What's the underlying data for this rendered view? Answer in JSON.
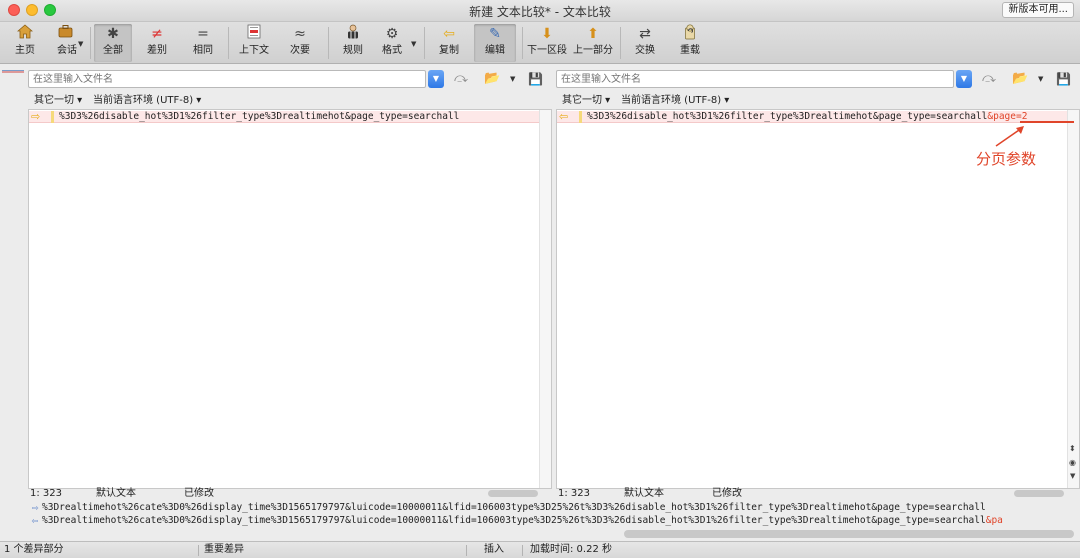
{
  "window": {
    "title": "新建 文本比较* - 文本比较",
    "update_button": "新版本可用..."
  },
  "toolbar": {
    "items": [
      {
        "label": "主页",
        "icon": "home-icon"
      },
      {
        "label": "会话",
        "icon": "briefcase-icon"
      },
      {
        "label": "全部",
        "icon": "asterisk-icon",
        "glyph": "✱",
        "active": true
      },
      {
        "label": "差别",
        "icon": "not-equal-icon",
        "glyph": "≠"
      },
      {
        "label": "相同",
        "icon": "equal-icon",
        "glyph": "="
      },
      {
        "label": "上下文",
        "icon": "context-icon"
      },
      {
        "label": "次要",
        "icon": "approx-icon",
        "glyph": "≈"
      },
      {
        "label": "规则",
        "icon": "referee-icon"
      },
      {
        "label": "格式",
        "icon": "format-gear-icon",
        "glyph": "⚙"
      },
      {
        "label": "复制",
        "icon": "copy-arrow-icon",
        "glyph": "⇦"
      },
      {
        "label": "编辑",
        "icon": "edit-icon",
        "glyph": "✎",
        "active": true
      },
      {
        "label": "下一区段",
        "icon": "next-section-icon",
        "glyph": "⬇"
      },
      {
        "label": "上一部分",
        "icon": "prev-section-icon",
        "glyph": "⬆"
      },
      {
        "label": "交换",
        "icon": "swap-icon",
        "glyph": "⇄"
      },
      {
        "label": "重载",
        "icon": "reload-icon"
      }
    ]
  },
  "left_pane": {
    "path_placeholder": "在这里输入文件名",
    "format_menu": "其它一切 ▾",
    "encoding_menu": "当前语言环境 (UTF-8) ▾",
    "line_text": "%3D3%26disable_hot%3D1%26filter_type%3Drealtimehot&page_type=searchall",
    "status_pos": "1: 323",
    "status_type": "默认文本",
    "status_state": "已修改"
  },
  "right_pane": {
    "path_placeholder": "在这里输入文件名",
    "format_menu": "其它一切 ▾",
    "encoding_menu": "当前语言环境 (UTF-8) ▾",
    "line_text": "%3D3%26disable_hot%3D1%26filter_type%3Drealtimehot&page_type=searchall",
    "line_highlight": "&page=2",
    "status_pos": "1: 323",
    "status_type": "默认文本",
    "status_state": "已修改",
    "annotation": "分页参数"
  },
  "compare_lines": {
    "left": "%3Drealtimehot%26cate%3D0%26display_time%3D1565179797&luicode=10000011&lfid=106003type%3D25%26t%3D3%26disable_hot%3D1%26filter_type%3Drealtimehot&page_type=searchall",
    "right": "%3Drealtimehot%26cate%3D0%26display_time%3D1565179797&luicode=10000011&lfid=106003type%3D25%26t%3D3%26disable_hot%3D1%26filter_type%3Drealtimehot&page_type=searchall",
    "right_highlight": "&pa"
  },
  "footer": {
    "diff_count": "1 个差异部分",
    "importance": "重要差异",
    "mode": "插入",
    "load_time": "加载时间: 0.22 秒"
  },
  "colors": {
    "accent": "#2e78e6",
    "diff_highlight": "#e0452a",
    "diff_line_bg": "#fde8e8"
  }
}
